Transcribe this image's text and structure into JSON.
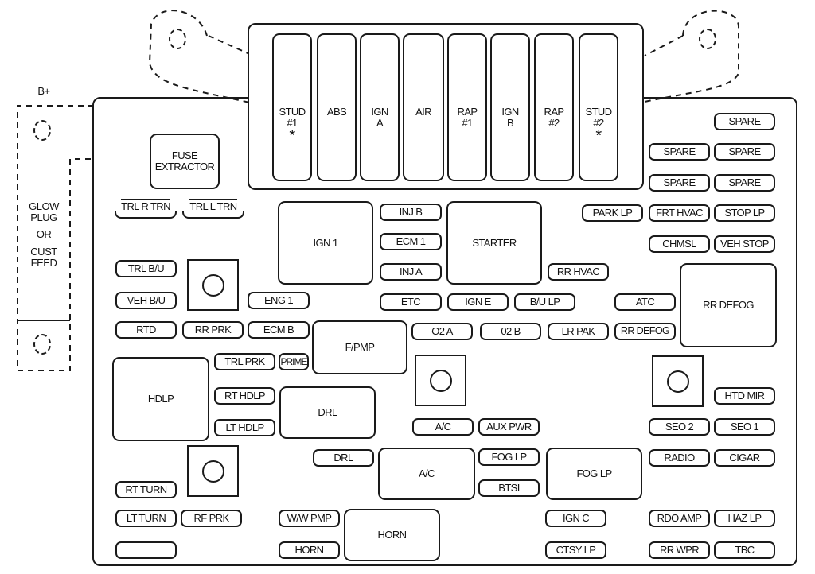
{
  "diagram": {
    "b_plus_label": "B+",
    "glow_plug_label": [
      "GLOW",
      "PLUG",
      "OR",
      "CUST",
      "FEED"
    ],
    "fuse_extractor": "FUSE EXTRACTOR",
    "maxi_fuses": [
      {
        "line1": "STUD",
        "line2": "#1",
        "mark": "*"
      },
      {
        "line1": "ABS",
        "line2": "",
        "mark": ""
      },
      {
        "line1": "IGN",
        "line2": "A",
        "mark": ""
      },
      {
        "line1": "AIR",
        "line2": "",
        "mark": ""
      },
      {
        "line1": "RAP",
        "line2": "#1",
        "mark": ""
      },
      {
        "line1": "IGN",
        "line2": "B",
        "mark": ""
      },
      {
        "line1": "RAP",
        "line2": "#2",
        "mark": ""
      },
      {
        "line1": "STUD",
        "line2": "#2",
        "mark": "*"
      }
    ],
    "trailer_labels": {
      "trl_r_trn": "TRL R TRN",
      "trl_l_trn": "TRL L TRN"
    },
    "relays": {
      "ign1": "IGN 1",
      "starter": "STARTER",
      "rr_defog": "RR DEFOG",
      "f_pmp": "F/PMP",
      "hdlp": "HDLP",
      "drl": "DRL",
      "ac": "A/C",
      "fog_lp": "FOG LP",
      "horn": "HORN"
    },
    "fuses": {
      "spare_1": "SPARE",
      "spare_2": "SPARE",
      "spare_3": "SPARE",
      "spare_4": "SPARE",
      "spare_5": "SPARE",
      "park_lp": "PARK LP",
      "frt_hvac": "FRT HVAC",
      "stop_lp": "STOP LP",
      "chmsl": "CHMSL",
      "veh_stop": "VEH STOP",
      "inj_b": "INJ B",
      "ecm_1": "ECM 1",
      "inj_a": "INJ A",
      "rr_hvac": "RR HVAC",
      "trl_bu": "TRL B/U",
      "veh_bu": "VEH B/U",
      "eng_1": "ENG 1",
      "etc": "ETC",
      "ign_e": "IGN E",
      "bu_lp": "B/U LP",
      "atc": "ATC",
      "rtd": "RTD",
      "rr_prk": "RR PRK",
      "ecm_b": "ECM B",
      "o2_a": "O2 A",
      "o2_b": "02 B",
      "lr_pak": "LR PAK",
      "rr_defog_fuse": "RR DEFOG",
      "trl_prk": "TRL PRK",
      "prime": "PRIME",
      "rt_hdlp": "RT HDLP",
      "lt_hdlp": "LT HDLP",
      "htd_mir": "HTD MIR",
      "ac_fuse": "A/C",
      "aux_pwr": "AUX PWR",
      "seo_2": "SEO 2",
      "seo_1": "SEO 1",
      "drl_fuse": "DRL",
      "fog_lp_fuse": "FOG LP",
      "btsi": "BTSI",
      "radio": "RADIO",
      "cigar": "CIGAR",
      "rt_turn": "RT TURN",
      "lt_turn": "LT TURN",
      "rf_prk": "RF PRK",
      "ww_pmp": "W/W PMP",
      "horn_fuse": "HORN",
      "ign_c": "IGN C",
      "ctsy_lp": "CTSY LP",
      "rdo_amp": "RDO AMP",
      "haz_lp": "HAZ LP",
      "rr_wpr": "RR WPR",
      "tbc": "TBC"
    }
  }
}
